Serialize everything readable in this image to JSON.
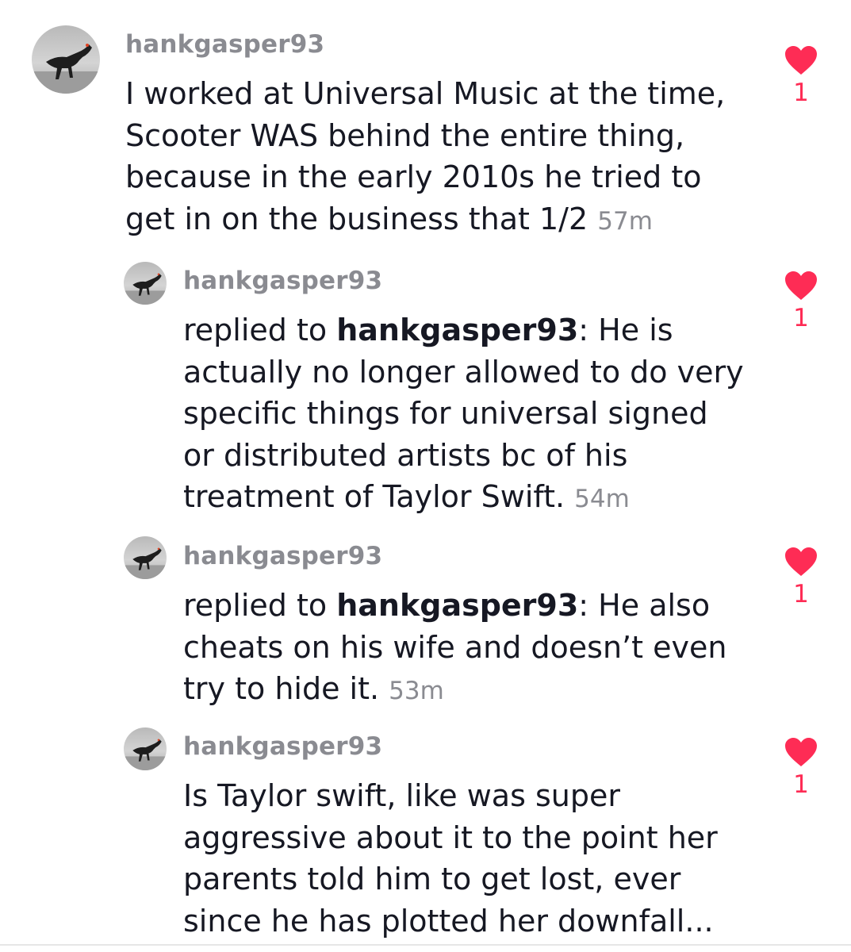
{
  "comments": [
    {
      "username": "hankgasper93",
      "reply_prefix": "",
      "reply_to": "",
      "text": "I worked at Universal Music at the time,\nScooter WAS behind the entire thing,\nbecause in the early 2010s he tried to\nget in on the business that 1/2",
      "time": "57m",
      "likes": "1",
      "avatar_icon": "dinosaur-avatar-icon"
    },
    {
      "username": "hankgasper93",
      "reply_prefix": "replied to ",
      "reply_to": "hankgasper93",
      "text": ": He is\nactually no longer allowed to do very\nspecific things for universal signed\nor distributed artists bc of his\ntreatment of Taylor Swift.",
      "time": "54m",
      "likes": "1",
      "avatar_icon": "dinosaur-avatar-icon"
    },
    {
      "username": "hankgasper93",
      "reply_prefix": "replied to ",
      "reply_to": "hankgasper93",
      "text": ": He also\ncheats on his wife and doesn’t even\ntry to hide it.",
      "time": "53m",
      "likes": "1",
      "avatar_icon": "dinosaur-avatar-icon"
    },
    {
      "username": "hankgasper93",
      "reply_prefix": "",
      "reply_to": "",
      "text": "Is Taylor swift, like was super\naggressive about it to the point her\nparents told him to get lost, ever\nsince he has plotted her downfall...",
      "time": "",
      "likes": "1",
      "avatar_icon": "dinosaur-avatar-icon"
    }
  ],
  "colors": {
    "like_heart": "#fe2c55",
    "username": "#8a8b91",
    "text": "#161823"
  }
}
